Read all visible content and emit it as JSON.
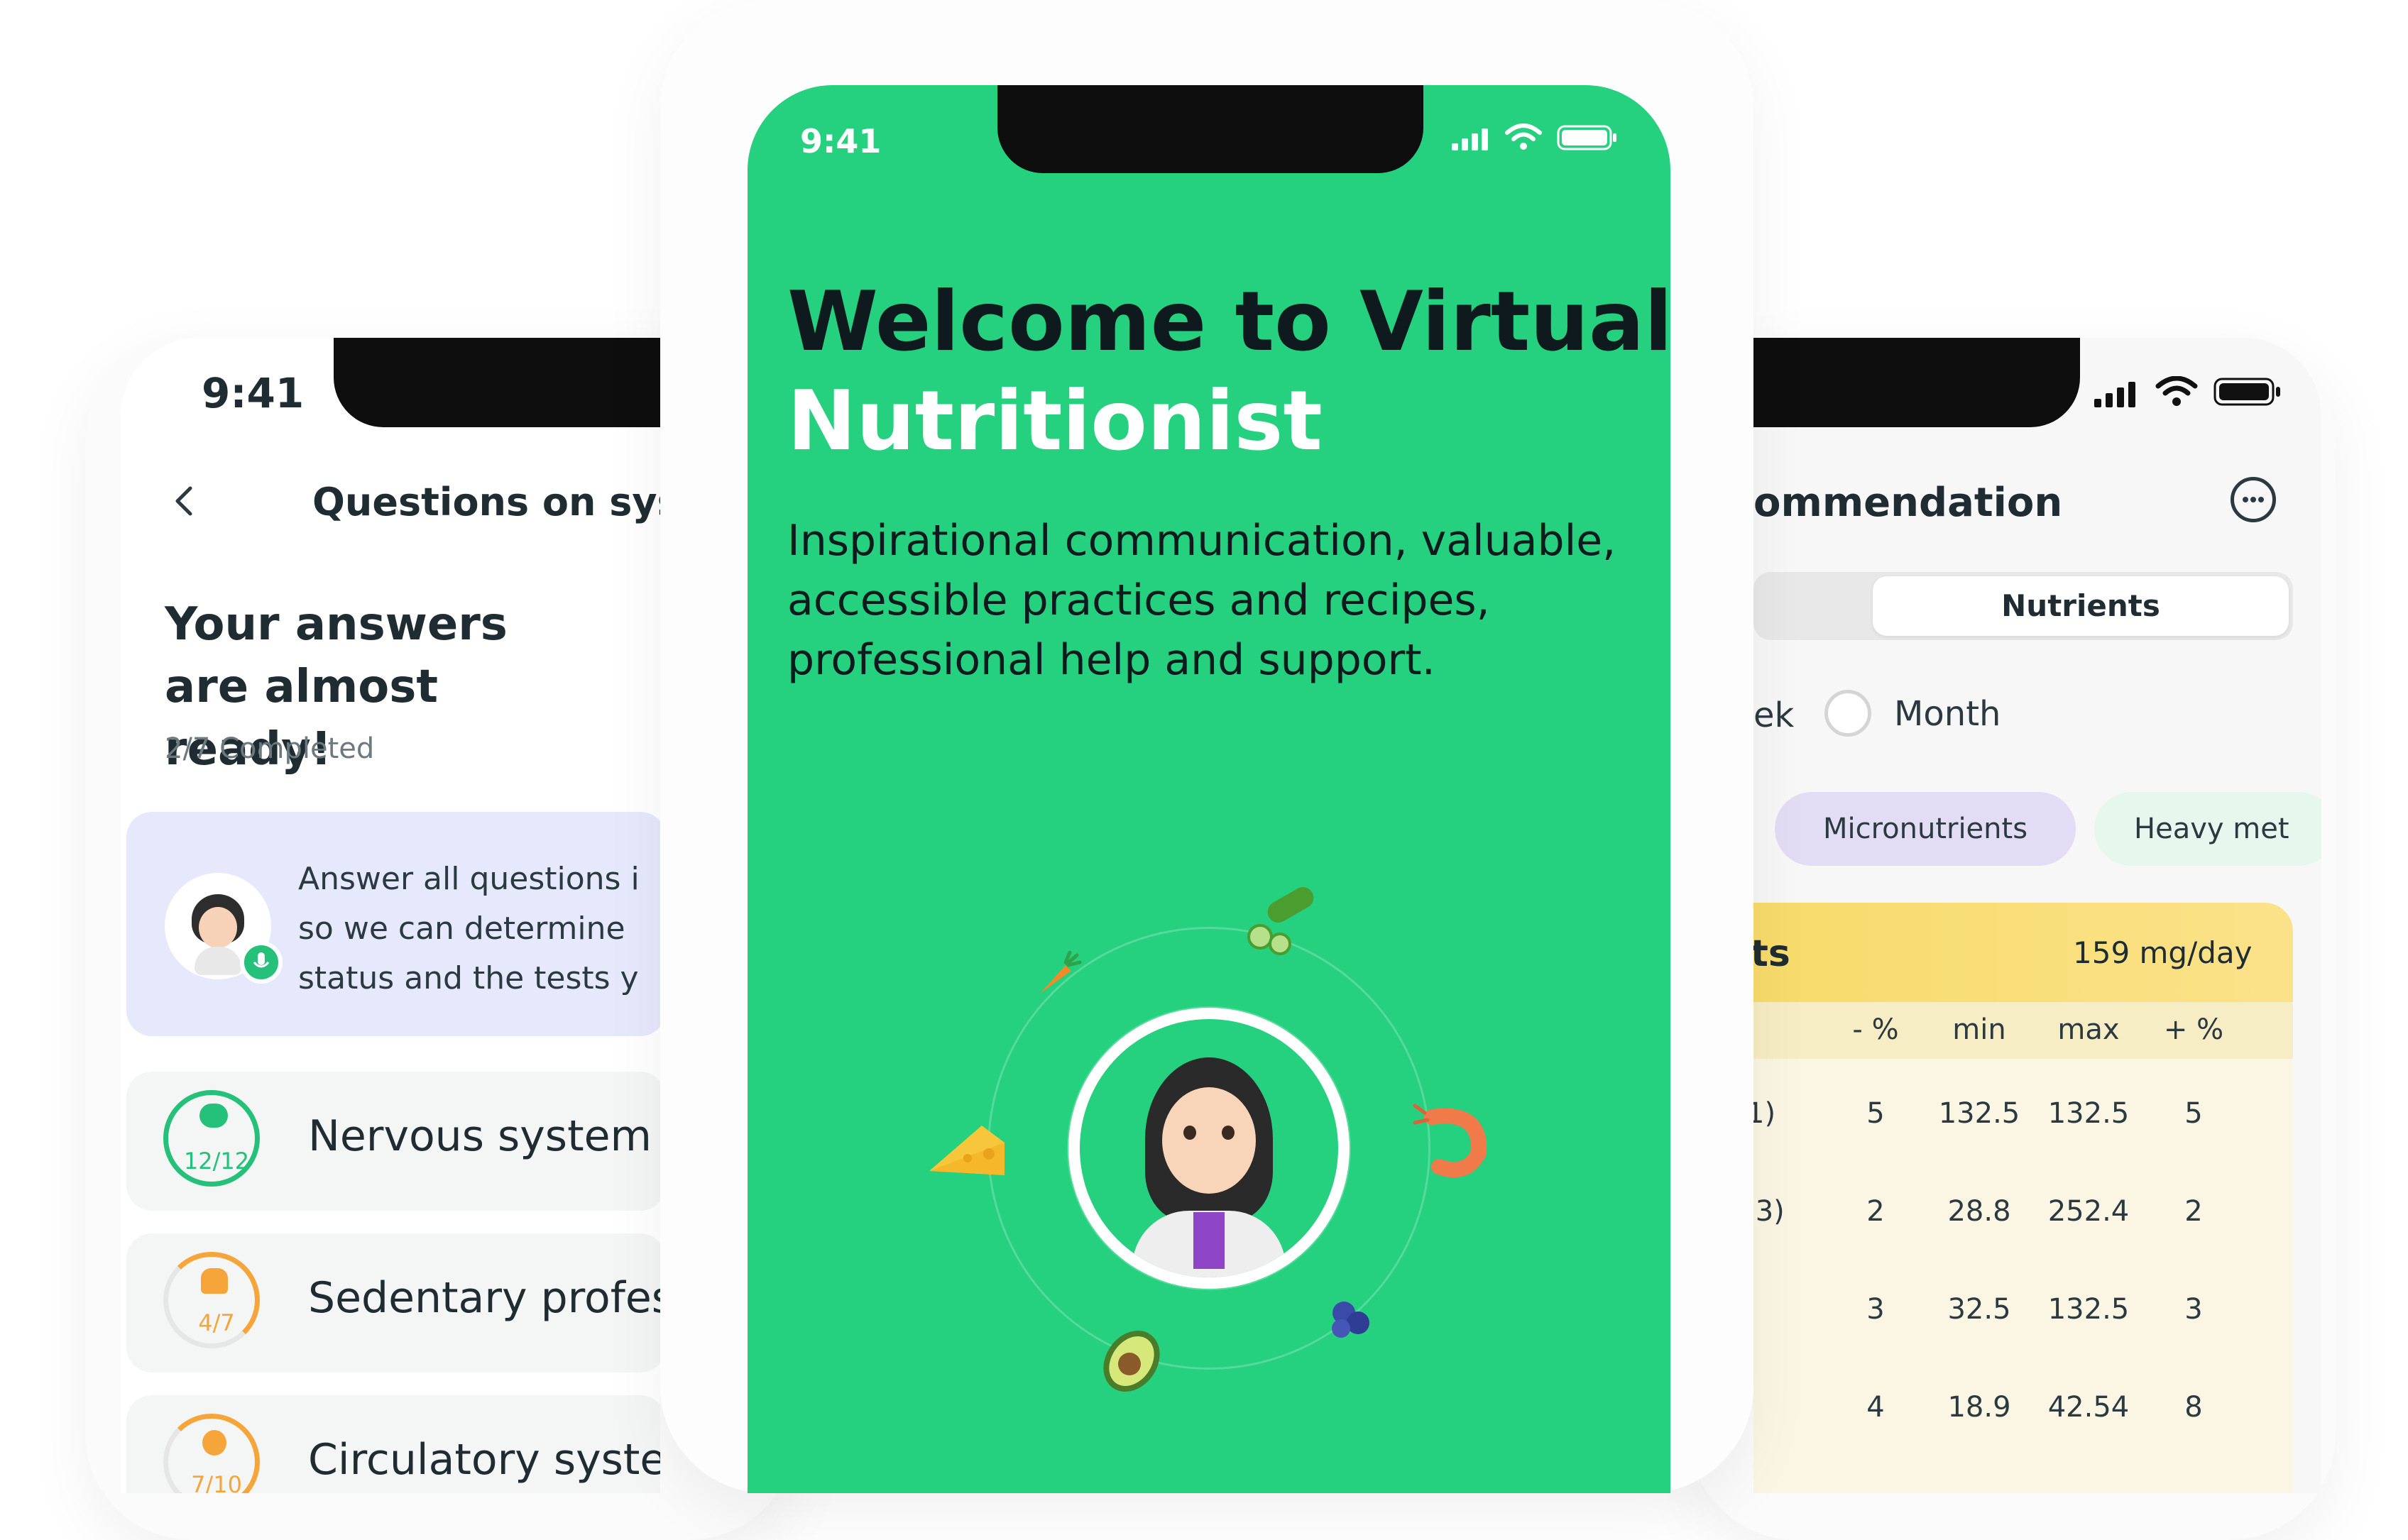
{
  "left_phone": {
    "status_time": "9:41",
    "header_title": "Questions on sys",
    "heading": "Your answers are almost ready!",
    "progress_text": "2/7 Completed",
    "info_text": [
      "Answer all questions i",
      "so we can determine",
      "status and the tests y"
    ],
    "systems": [
      {
        "label": "Nervous system",
        "count": "12/12",
        "color": "#25c07a",
        "icon": "brain-icon"
      },
      {
        "label": "Sedentary profes",
        "count": "4/7",
        "color": "#f5a53a",
        "icon": "lungs-icon"
      },
      {
        "label": "Circulatory syster",
        "count": "7/10",
        "color": "#f5a53a",
        "icon": "heart-icon"
      }
    ]
  },
  "center_phone": {
    "status_time": "9:41",
    "title_line1": "Welcome to Virtual",
    "title_line2": "Nutritionist",
    "subtitle": [
      "Inspirational communication, valuable,",
      "accessible practices and recipes,",
      "professional help and support."
    ],
    "accent": "#25d07e",
    "foods": [
      "carrot-icon",
      "cucumber-icon",
      "cheese-icon",
      "shrimp-icon",
      "avocado-icon",
      "blueberry-icon"
    ]
  },
  "right_phone": {
    "header_title": "ommendation",
    "segment_selected": "Nutrients",
    "radio_left": "ek",
    "radio_month": "Month",
    "chips": [
      "Micronutrients",
      "Heavy met"
    ],
    "card_title": "ts",
    "card_value": "159 mg/day",
    "table_headers": [
      "- %",
      "min",
      "max",
      "+ %"
    ],
    "table_rows": [
      {
        "label": "1)",
        "cells": [
          "5",
          "132.5",
          "132.5",
          "5"
        ]
      },
      {
        "label": ".3)",
        "cells": [
          "2",
          "28.8",
          "252.4",
          "2"
        ]
      },
      {
        "label": "",
        "cells": [
          "3",
          "32.5",
          "132.5",
          "3"
        ]
      },
      {
        "label": "",
        "cells": [
          "4",
          "18.9",
          "42.54",
          "8"
        ]
      }
    ]
  }
}
